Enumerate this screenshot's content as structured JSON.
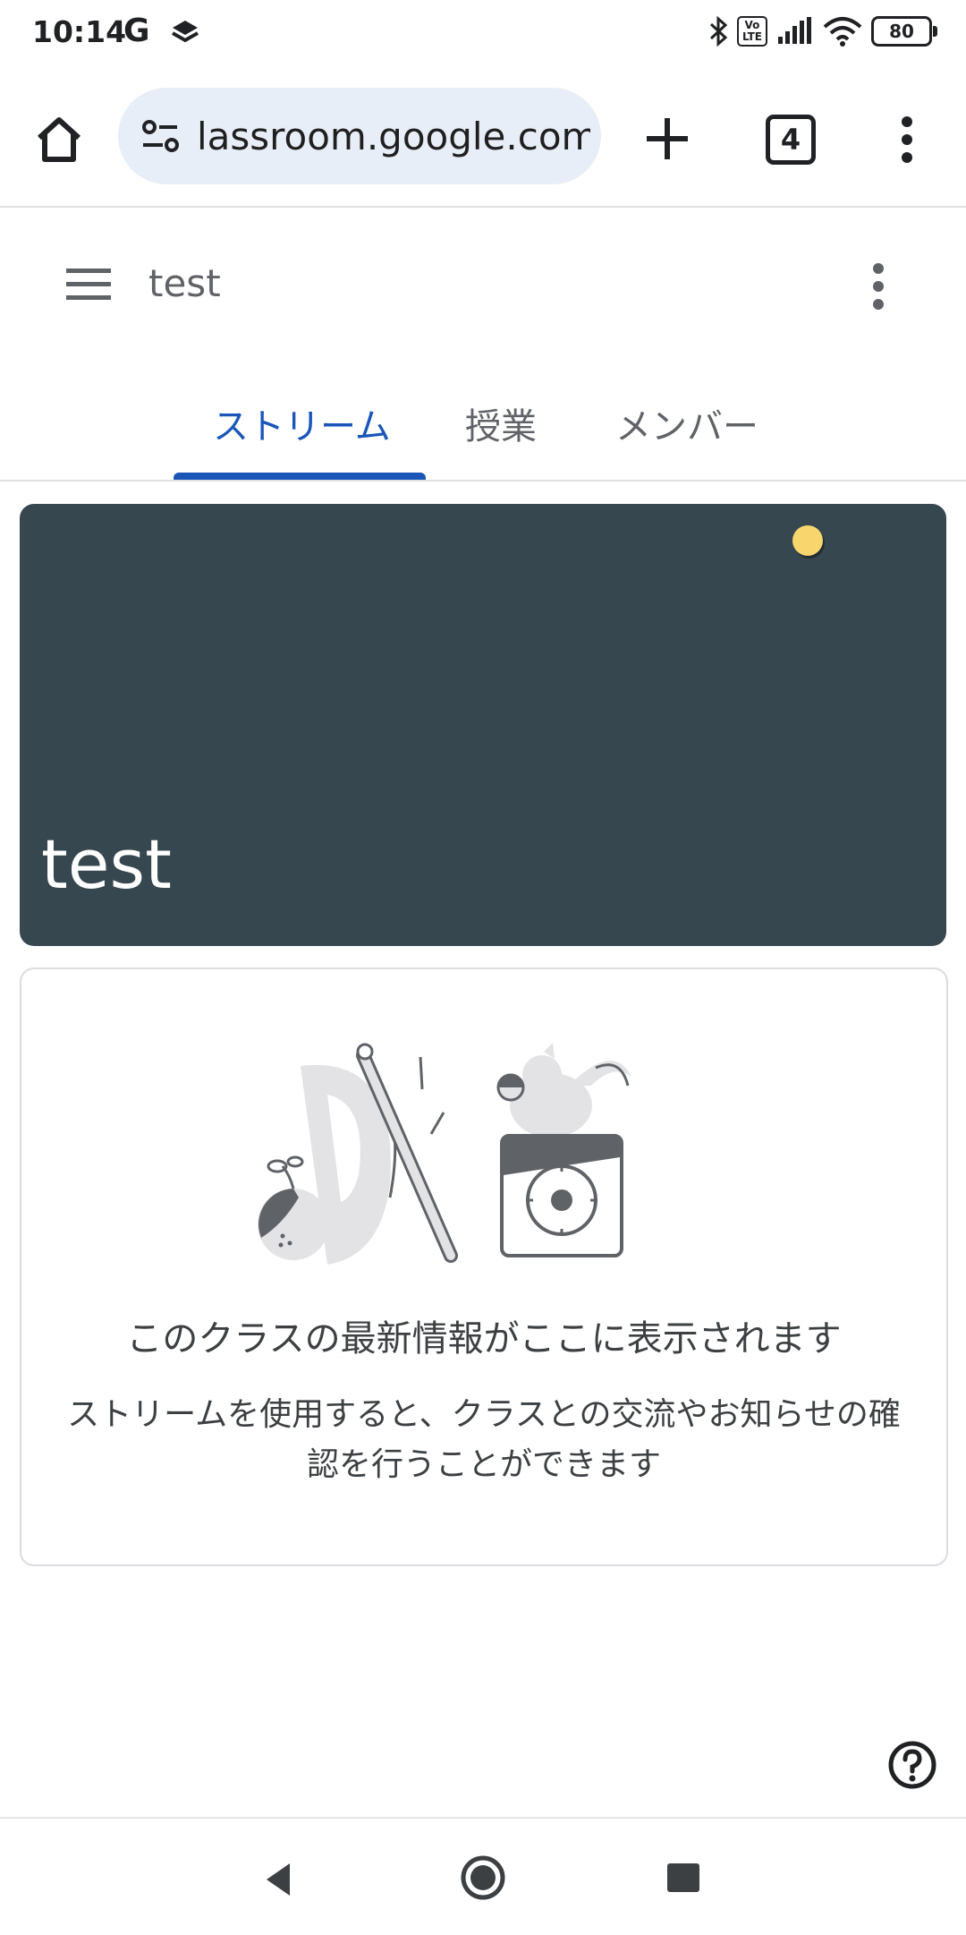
{
  "status_bar": {
    "time": "10:14",
    "g_label": "G",
    "volte": "Vo\nLTE",
    "battery": "80"
  },
  "browser": {
    "url": "lassroom.google.com",
    "tab_count": "4",
    "icons": [
      "home-icon",
      "site-settings-icon",
      "plus-icon",
      "tab-switcher-icon",
      "more-vert-icon"
    ]
  },
  "classroom": {
    "class_name": "test",
    "tabs": [
      {
        "label": "ストリーム",
        "active": true
      },
      {
        "label": "授業",
        "active": false
      },
      {
        "label": "メンバー",
        "active": false
      }
    ],
    "banner": {
      "title": "test",
      "background_color": "#37474f",
      "accent_dot_color": "#f8d66d"
    },
    "empty_state": {
      "title": "このクラスの最新情報がここに表示されます",
      "description": "ストリームを使用すると、クラスとの交流やお知らせの確認を行うことができます"
    }
  },
  "colors": {
    "accent": "#1a56b8"
  }
}
